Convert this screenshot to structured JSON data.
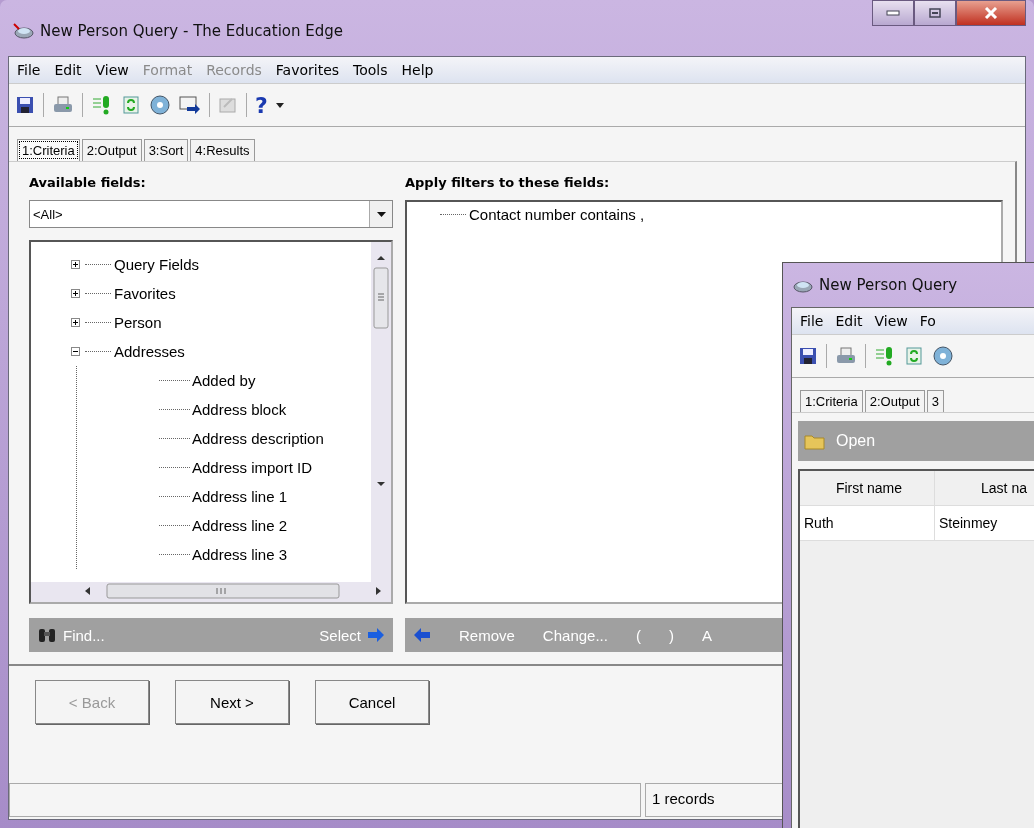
{
  "window": {
    "title": "New Person Query - The Education Edge"
  },
  "menu": [
    {
      "label": "File",
      "disabled": false
    },
    {
      "label": "Edit",
      "disabled": false
    },
    {
      "label": "View",
      "disabled": false
    },
    {
      "label": "Format",
      "disabled": true
    },
    {
      "label": "Records",
      "disabled": true
    },
    {
      "label": "Favorites",
      "disabled": false
    },
    {
      "label": "Tools",
      "disabled": false
    },
    {
      "label": "Help",
      "disabled": false
    }
  ],
  "toolbar": {
    "help_glyph": "?"
  },
  "tabs": [
    {
      "label": "1:Criteria",
      "selected": true
    },
    {
      "label": "2:Output",
      "selected": false
    },
    {
      "label": "3:Sort",
      "selected": false
    },
    {
      "label": "4:Results",
      "selected": false
    }
  ],
  "available_fields": {
    "heading": "Available fields:",
    "dropdown": "<All>",
    "tree": [
      {
        "label": "Query Fields",
        "expanded": false
      },
      {
        "label": "Favorites",
        "expanded": false
      },
      {
        "label": "Person",
        "expanded": false
      },
      {
        "label": "Addresses",
        "expanded": true,
        "children": [
          {
            "label": "Added by"
          },
          {
            "label": "Address block"
          },
          {
            "label": "Address description"
          },
          {
            "label": "Address import ID"
          },
          {
            "label": "Address line 1"
          },
          {
            "label": "Address line 2"
          },
          {
            "label": "Address line 3"
          }
        ]
      }
    ],
    "find": "Find...",
    "select": "Select"
  },
  "filters": {
    "heading": "Apply filters to these fields:",
    "items": [
      "Contact number contains ,"
    ],
    "actions": [
      "Remove",
      "Change...",
      "(",
      ")",
      "A"
    ]
  },
  "buttons": [
    {
      "label": "< Back",
      "disabled": true
    },
    {
      "label": "Next >",
      "disabled": false
    },
    {
      "label": "Cancel",
      "disabled": false
    }
  ],
  "status_bar": {
    "records": "1 records"
  },
  "second_window": {
    "title": "New Person Query",
    "menu": [
      "File",
      "Edit",
      "View",
      "Fo"
    ],
    "tabs": [
      {
        "label": "1:Criteria",
        "selected": false
      },
      {
        "label": "2:Output",
        "selected": false
      },
      {
        "label": "3",
        "selected": false
      }
    ],
    "open": "Open",
    "columns": [
      "First name",
      "Last na"
    ],
    "rows": [
      [
        "Ruth",
        "Steinmey"
      ]
    ]
  }
}
